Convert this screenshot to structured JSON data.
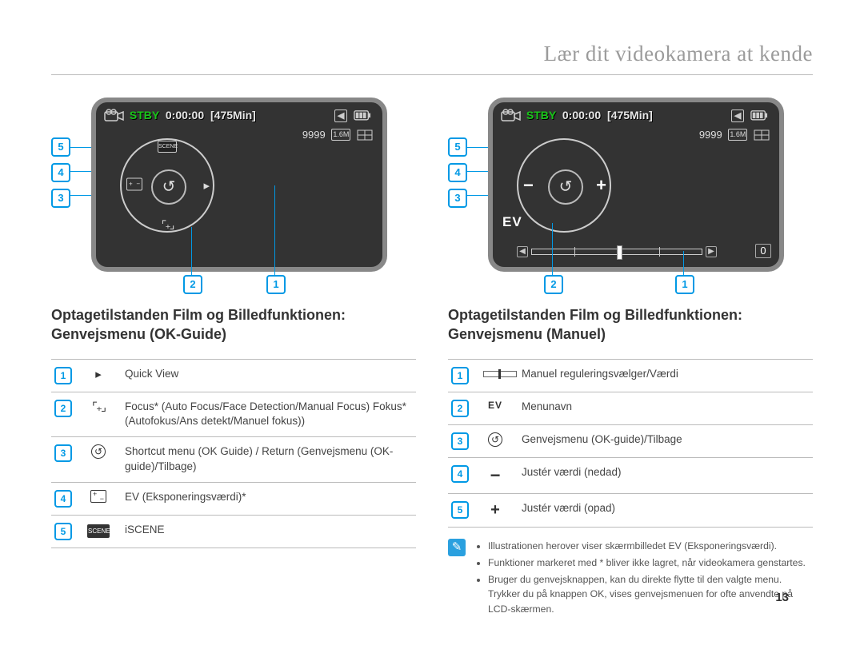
{
  "header": {
    "title": "Lær dit videokamera at kende"
  },
  "lcd": {
    "stby": "STBY",
    "timecode": "0:00:00",
    "minutes": "[475Min]",
    "count": "9999",
    "res_badge": "1.6M",
    "ev_label": "EV",
    "slider_value": "0"
  },
  "wheel_left": {
    "top": "SCENE",
    "center": "↺"
  },
  "wheel_right": {
    "left": "−",
    "right": "+",
    "center": "↺"
  },
  "left": {
    "heading": "Optagetilstanden Film og Billedfunktionen: Genvejsmenu (OK-Guide)",
    "items": [
      {
        "num": "1",
        "icon": "play",
        "text": "Quick View"
      },
      {
        "num": "2",
        "icon": "focus",
        "text": "Focus* (Auto Focus/Face Detection/Manual Focus) Fokus* (Autofokus/Ans detekt/Manuel fokus))"
      },
      {
        "num": "3",
        "icon": "return",
        "text": "Shortcut menu (OK Guide) / Return (Genvejsmenu (OK-guide)/Tilbage)"
      },
      {
        "num": "4",
        "icon": "ev",
        "text": "EV (Eksponeringsværdi)*"
      },
      {
        "num": "5",
        "icon": "scene",
        "text": "iSCENE"
      }
    ]
  },
  "right": {
    "heading": "Optagetilstanden Film og Billedfunktionen: Genvejsmenu (Manuel)",
    "items": [
      {
        "num": "1",
        "icon": "slider",
        "text": "Manuel reguleringsvælger/Værdi"
      },
      {
        "num": "2",
        "icon": "evtext",
        "text": "Menunavn"
      },
      {
        "num": "3",
        "icon": "return",
        "text": "Genvejsmenu (OK-guide)/Tilbage"
      },
      {
        "num": "4",
        "icon": "minus",
        "text": "Justér værdi (nedad)"
      },
      {
        "num": "5",
        "icon": "plus",
        "text": "Justér værdi (opad)"
      }
    ]
  },
  "notes": [
    "Illustrationen herover viser skærmbilledet EV (Eksponeringsværdi).",
    "Funktioner markeret med * bliver ikke lagret, når videokamera genstartes.",
    "Bruger du genvejsknappen, kan du direkte flytte til den valgte menu. Trykker du på knappen OK, vises genvejsmenuen for ofte anvendte på LCD-skærmen."
  ],
  "page_number": "13"
}
